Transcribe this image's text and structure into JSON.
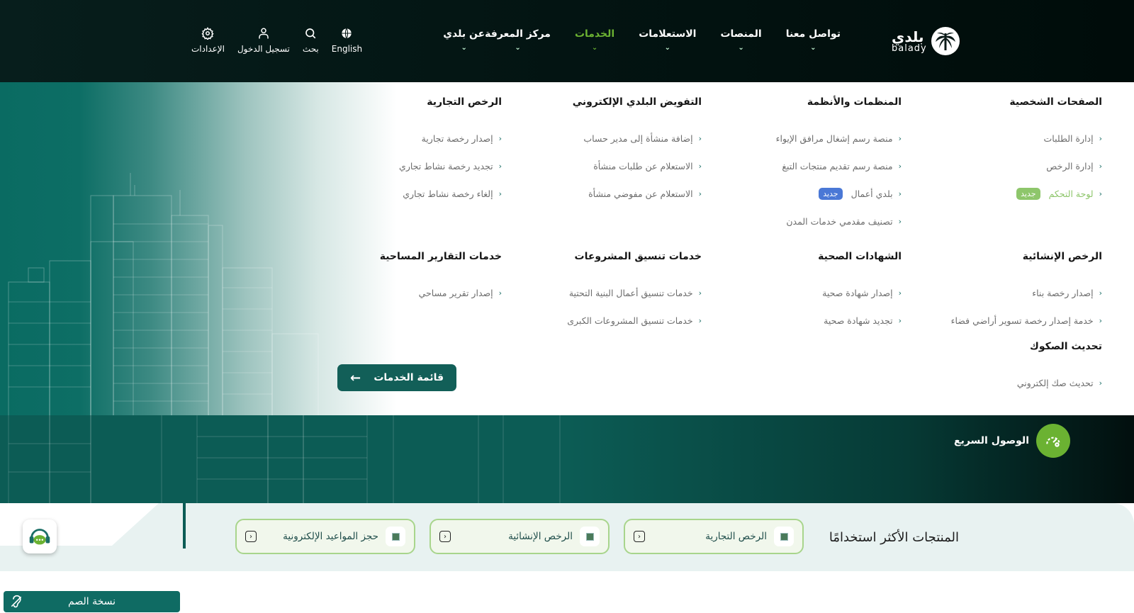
{
  "header": {
    "logo": {
      "ar": "بلدي",
      "en": "balady"
    },
    "nav": [
      {
        "label": "عن بلدي",
        "active": false
      },
      {
        "label": "مركز المعرفة",
        "active": false
      },
      {
        "label": "الخدمات",
        "active": true
      },
      {
        "label": "الاستعلامات",
        "active": false
      },
      {
        "label": "المنصات",
        "active": false
      },
      {
        "label": "تواصل معنا",
        "active": false
      }
    ],
    "tools": [
      {
        "label": "الإعدادات",
        "icon": "gear-icon"
      },
      {
        "label": "تسجيل الدخول",
        "icon": "user-icon"
      },
      {
        "label": "بحث",
        "icon": "search-icon"
      },
      {
        "label": "English",
        "icon": "globe-icon"
      }
    ],
    "active_color": "#6bb232"
  },
  "mega_menu": {
    "columns": [
      {
        "title": "الصفحات الشخصية",
        "items": [
          {
            "label": "إدارة الطلبات"
          },
          {
            "label": "إدارة الرخص"
          },
          {
            "label": "لوحة التحكم",
            "badge": "جديد",
            "badge_color": "#8ec66b",
            "highlight": true
          }
        ]
      },
      {
        "title": "المنظمات والأنظمة",
        "items": [
          {
            "label": "منصة رسم إشغال مرافق الإيواء"
          },
          {
            "label": "منصة رسم تقديم منتجات التبغ"
          },
          {
            "label": "بلدي أعمال",
            "badge": "جديد",
            "badge_color": "#4a78d6"
          },
          {
            "label": "تصنيف مقدمي خدمات المدن"
          }
        ]
      },
      {
        "title": "التفويض البلدي الإلكتروني",
        "items": [
          {
            "label": "إضافة منشأة إلى مدير حساب"
          },
          {
            "label": "الاستعلام عن طلبات منشأة"
          },
          {
            "label": "الاستعلام عن مفوضي منشأة"
          }
        ]
      },
      {
        "title": "الرخص التجارية",
        "items": [
          {
            "label": "إصدار رخصة تجارية"
          },
          {
            "label": "تجديد رخصة نشاط تجاري"
          },
          {
            "label": "إلغاء رخصة نشاط تجاري"
          }
        ]
      },
      {
        "title": "الرخص الإنشائية",
        "items": [
          {
            "label": "إصدار رخصة بناء"
          },
          {
            "label": "خدمة إصدار رخصة تسوير أراضي فضاء"
          }
        ]
      },
      {
        "title": "الشهادات الصحية",
        "items": [
          {
            "label": "إصدار شهادة صحية"
          },
          {
            "label": "تجديد شهادة صحية"
          }
        ]
      },
      {
        "title": "خدمات تنسيق المشروعات",
        "items": [
          {
            "label": "خدمات تنسيق أعمال البنية التحتية"
          },
          {
            "label": "خدمات تنسيق المشروعات الكبرى"
          }
        ]
      },
      {
        "title": "خدمات التقارير المساحية",
        "items": [
          {
            "label": "إصدار تقرير مساحي"
          }
        ]
      },
      {
        "title": "تحديث الصكوك",
        "items": [
          {
            "label": "تحديث صك إلكتروني"
          }
        ]
      }
    ],
    "services_button": "قائمة الخدمات"
  },
  "quick_access": {
    "label": "الوصول السريع"
  },
  "most_used": {
    "title": "المنتجات الأكثر استخدامًا",
    "cards": [
      {
        "label": "الرخص التجارية"
      },
      {
        "label": "الرخص الإنشائية"
      },
      {
        "label": "حجز المواعيد الإلكترونية"
      }
    ]
  },
  "accessibility": {
    "deaf_version": "نسخة الصم"
  }
}
